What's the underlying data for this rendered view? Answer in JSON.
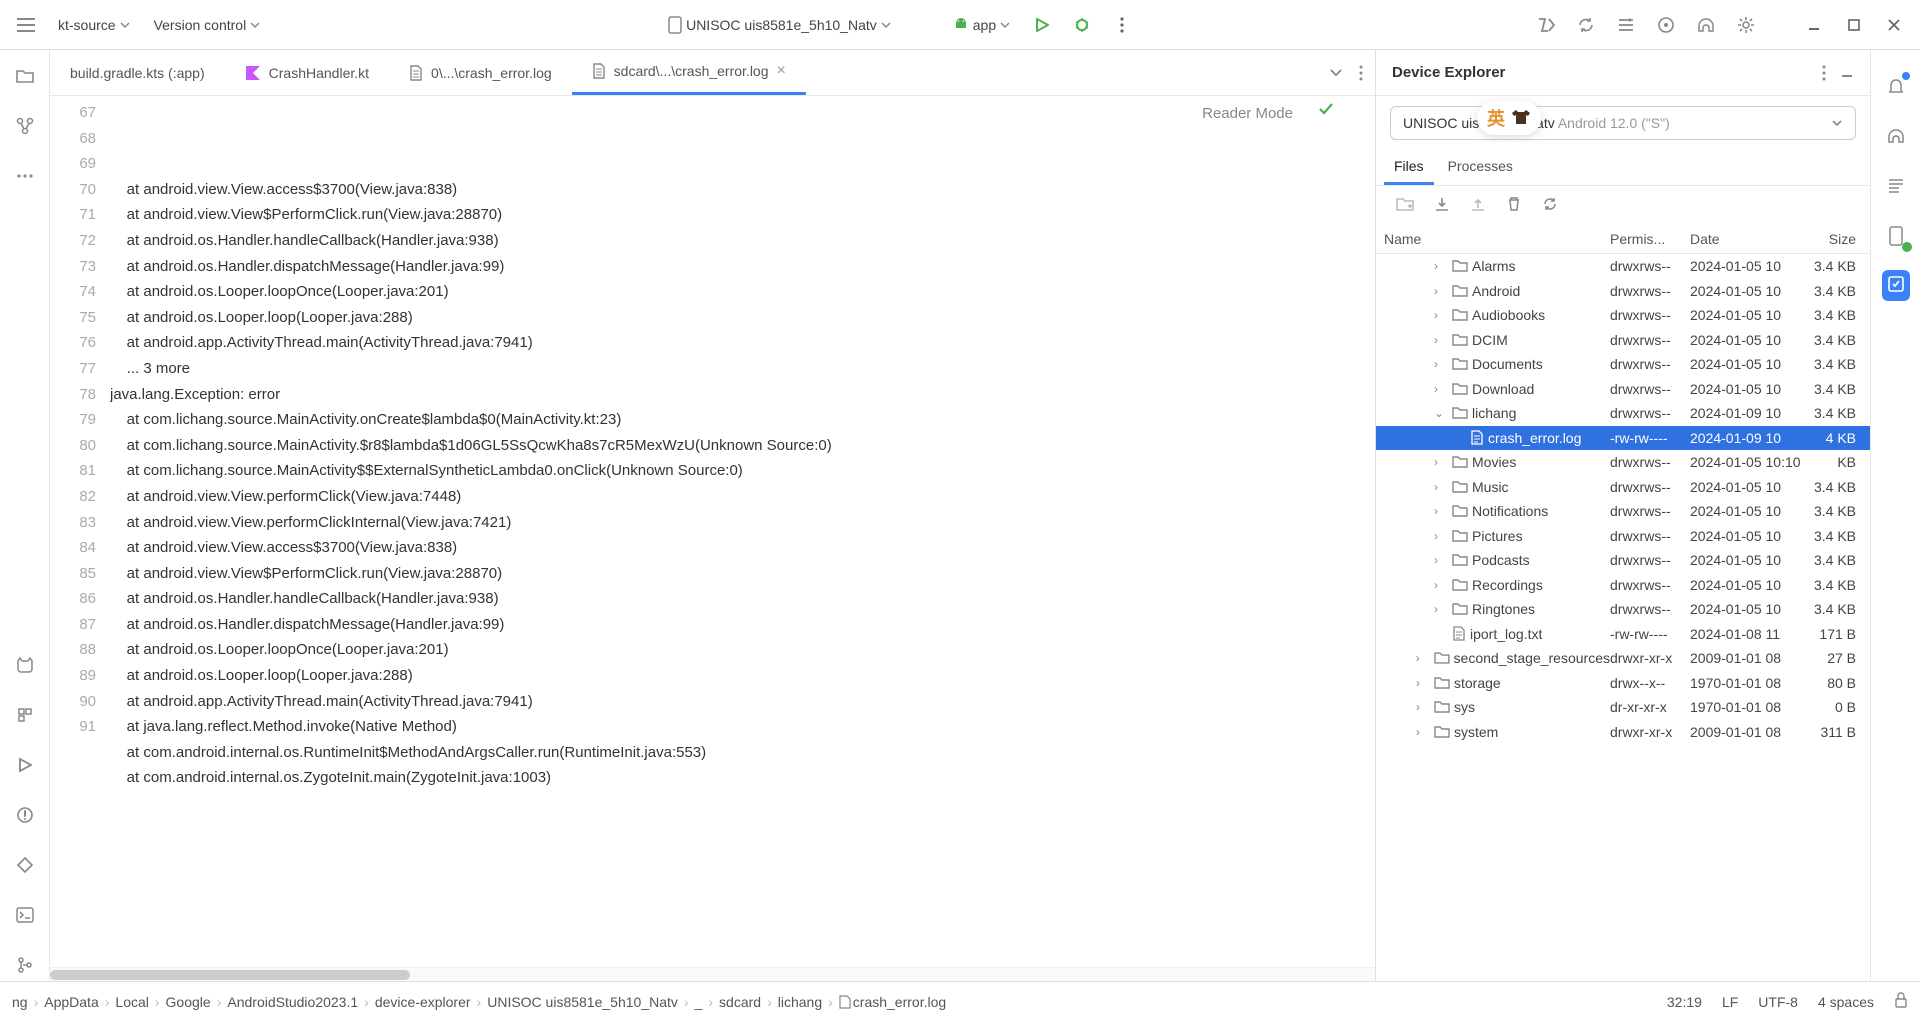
{
  "toolbar": {
    "project": "kt-source",
    "vcs": "Version control",
    "device": "UNISOC uis8581e_5h10_Natv",
    "run_config": "app"
  },
  "tabs": [
    {
      "label": "build.gradle.kts (:app)",
      "icon": "none",
      "active": false
    },
    {
      "label": "CrashHandler.kt",
      "icon": "kotlin",
      "active": false
    },
    {
      "label": "0\\...\\crash_error.log",
      "icon": "file",
      "active": false
    },
    {
      "label": "sdcard\\...\\crash_error.log",
      "icon": "file",
      "active": true
    }
  ],
  "editor": {
    "reader_mode": "Reader Mode",
    "first_line": 67,
    "lines": [
      "    at android.view.View.access$3700(View.java:838)",
      "    at android.view.View$PerformClick.run(View.java:28870)",
      "    at android.os.Handler.handleCallback(Handler.java:938)",
      "    at android.os.Handler.dispatchMessage(Handler.java:99)",
      "    at android.os.Looper.loopOnce(Looper.java:201)",
      "    at android.os.Looper.loop(Looper.java:288)",
      "    at android.app.ActivityThread.main(ActivityThread.java:7941)",
      "    ... 3 more",
      "java.lang.Exception: error",
      "    at com.lichang.source.MainActivity.onCreate$lambda$0(MainActivity.kt:23)",
      "    at com.lichang.source.MainActivity.$r8$lambda$1d06GL5SsQcwKha8s7cR5MexWzU(Unknown Source:0)",
      "    at com.lichang.source.MainActivity$$ExternalSyntheticLambda0.onClick(Unknown Source:0)",
      "    at android.view.View.performClick(View.java:7448)",
      "    at android.view.View.performClickInternal(View.java:7421)",
      "    at android.view.View.access$3700(View.java:838)",
      "    at android.view.View$PerformClick.run(View.java:28870)",
      "    at android.os.Handler.handleCallback(Handler.java:938)",
      "    at android.os.Handler.dispatchMessage(Handler.java:99)",
      "    at android.os.Looper.loopOnce(Looper.java:201)",
      "    at android.os.Looper.loop(Looper.java:288)",
      "    at android.app.ActivityThread.main(ActivityThread.java:7941)",
      "    at java.lang.reflect.Method.invoke(Native Method)",
      "    at com.android.internal.os.RuntimeInit$MethodAndArgsCaller.run(RuntimeInit.java:553)",
      "    at com.android.internal.os.ZygoteInit.main(ZygoteInit.java:1003)",
      ""
    ]
  },
  "device_explorer": {
    "title": "Device Explorer",
    "device_name": "UNISOC uis",
    "device_suffix": "Natv",
    "device_detail": "Android 12.0 (\"S\")",
    "ime": "英",
    "subtabs": [
      "Files",
      "Processes"
    ],
    "columns": {
      "name": "Name",
      "perm": "Permis...",
      "date": "Date",
      "size": "Size"
    },
    "rows": [
      {
        "indent": 2,
        "arrow": "right",
        "icon": "folder",
        "name": "Alarms",
        "perm": "drwxrws--",
        "date": "2024-01-05 10",
        "size": "3.4 KB"
      },
      {
        "indent": 2,
        "arrow": "right",
        "icon": "folder",
        "name": "Android",
        "perm": "drwxrws--",
        "date": "2024-01-05 10",
        "size": "3.4 KB"
      },
      {
        "indent": 2,
        "arrow": "right",
        "icon": "folder",
        "name": "Audiobooks",
        "perm": "drwxrws--",
        "date": "2024-01-05 10",
        "size": "3.4 KB"
      },
      {
        "indent": 2,
        "arrow": "right",
        "icon": "folder",
        "name": "DCIM",
        "perm": "drwxrws--",
        "date": "2024-01-05 10",
        "size": "3.4 KB"
      },
      {
        "indent": 2,
        "arrow": "right",
        "icon": "folder",
        "name": "Documents",
        "perm": "drwxrws--",
        "date": "2024-01-05 10",
        "size": "3.4 KB"
      },
      {
        "indent": 2,
        "arrow": "right",
        "icon": "folder",
        "name": "Download",
        "perm": "drwxrws--",
        "date": "2024-01-05 10",
        "size": "3.4 KB"
      },
      {
        "indent": 2,
        "arrow": "down",
        "icon": "folder",
        "name": "lichang",
        "perm": "drwxrws--",
        "date": "2024-01-09 10",
        "size": "3.4 KB"
      },
      {
        "indent": 3,
        "arrow": "",
        "icon": "file",
        "name": "crash_error.log",
        "perm": "-rw-rw----",
        "date": "2024-01-09 10",
        "size": "4 KB",
        "selected": true
      },
      {
        "indent": 2,
        "arrow": "right",
        "icon": "folder",
        "name": "Movies",
        "perm": "drwxrws--",
        "date": "2024-01-05 10:10",
        "size": "KB"
      },
      {
        "indent": 2,
        "arrow": "right",
        "icon": "folder",
        "name": "Music",
        "perm": "drwxrws--",
        "date": "2024-01-05 10",
        "size": "3.4 KB"
      },
      {
        "indent": 2,
        "arrow": "right",
        "icon": "folder",
        "name": "Notifications",
        "perm": "drwxrws--",
        "date": "2024-01-05 10",
        "size": "3.4 KB"
      },
      {
        "indent": 2,
        "arrow": "right",
        "icon": "folder",
        "name": "Pictures",
        "perm": "drwxrws--",
        "date": "2024-01-05 10",
        "size": "3.4 KB"
      },
      {
        "indent": 2,
        "arrow": "right",
        "icon": "folder",
        "name": "Podcasts",
        "perm": "drwxrws--",
        "date": "2024-01-05 10",
        "size": "3.4 KB"
      },
      {
        "indent": 2,
        "arrow": "right",
        "icon": "folder",
        "name": "Recordings",
        "perm": "drwxrws--",
        "date": "2024-01-05 10",
        "size": "3.4 KB"
      },
      {
        "indent": 2,
        "arrow": "right",
        "icon": "folder",
        "name": "Ringtones",
        "perm": "drwxrws--",
        "date": "2024-01-05 10",
        "size": "3.4 KB"
      },
      {
        "indent": 2,
        "arrow": "",
        "icon": "file",
        "name": "iport_log.txt",
        "perm": "-rw-rw----",
        "date": "2024-01-08 11",
        "size": "171 B"
      },
      {
        "indent": 1,
        "arrow": "right",
        "icon": "folder",
        "name": "second_stage_resources",
        "perm": "drwxr-xr-x",
        "date": "2009-01-01 08",
        "size": "27 B"
      },
      {
        "indent": 1,
        "arrow": "right",
        "icon": "folder",
        "name": "storage",
        "perm": "drwx--x--",
        "date": "1970-01-01 08",
        "size": "80 B"
      },
      {
        "indent": 1,
        "arrow": "right",
        "icon": "folder",
        "name": "sys",
        "perm": "dr-xr-xr-x",
        "date": "1970-01-01 08",
        "size": "0 B"
      },
      {
        "indent": 1,
        "arrow": "right",
        "icon": "folder",
        "name": "system",
        "perm": "drwxr-xr-x",
        "date": "2009-01-01 08",
        "size": "311 B"
      }
    ]
  },
  "breadcrumb": [
    "ng",
    "AppData",
    "Local",
    "Google",
    "AndroidStudio2023.1",
    "device-explorer",
    "UNISOC uis8581e_5h10_Natv",
    "_",
    "sdcard",
    "lichang",
    "crash_error.log"
  ],
  "status": {
    "pos": "32:19",
    "le": "LF",
    "enc": "UTF-8",
    "indent": "4 spaces"
  }
}
